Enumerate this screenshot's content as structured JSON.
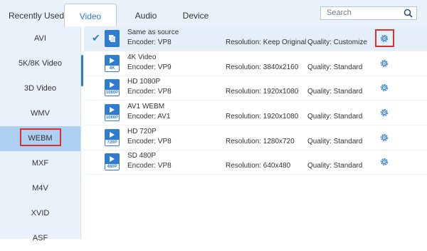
{
  "tabs": {
    "recent": "Recently Used",
    "video": "Video",
    "audio": "Audio",
    "device": "Device"
  },
  "search": {
    "placeholder": "Search",
    "icon": "search-icon"
  },
  "categories": [
    "AVI",
    "5K/8K Video",
    "3D Video",
    "WMV",
    "WEBM",
    "MXF",
    "M4V",
    "XVID",
    "ASF"
  ],
  "selected_category": "WEBM",
  "formats": [
    {
      "name": "Same as source",
      "encoder": "Encoder: VP8",
      "resolution": "Resolution: Keep Original",
      "quality": "Quality: Customize",
      "badge": ""
    },
    {
      "name": "4K Video",
      "encoder": "Encoder: VP9",
      "resolution": "Resolution: 3840x2160",
      "quality": "Quality: Standard",
      "badge": "4K"
    },
    {
      "name": "HD 1080P",
      "encoder": "Encoder: VP8",
      "resolution": "Resolution: 1920x1080",
      "quality": "Quality: Standard",
      "badge": "1080P"
    },
    {
      "name": "AV1 WEBM",
      "encoder": "Encoder: AV1",
      "resolution": "Resolution: 1920x1080",
      "quality": "Quality: Standard",
      "badge": "1080P"
    },
    {
      "name": "HD 720P",
      "encoder": "Encoder: VP8",
      "resolution": "Resolution: 1280x720",
      "quality": "Quality: Standard",
      "badge": "720P"
    },
    {
      "name": "SD 480P",
      "encoder": "Encoder: VP8",
      "resolution": "Resolution: 640x480",
      "quality": "Quality: Standard",
      "badge": "480P"
    }
  ],
  "colors": {
    "accent": "#2e7bd0",
    "highlight": "#d9312e",
    "selected_bg": "#aed0f3"
  }
}
